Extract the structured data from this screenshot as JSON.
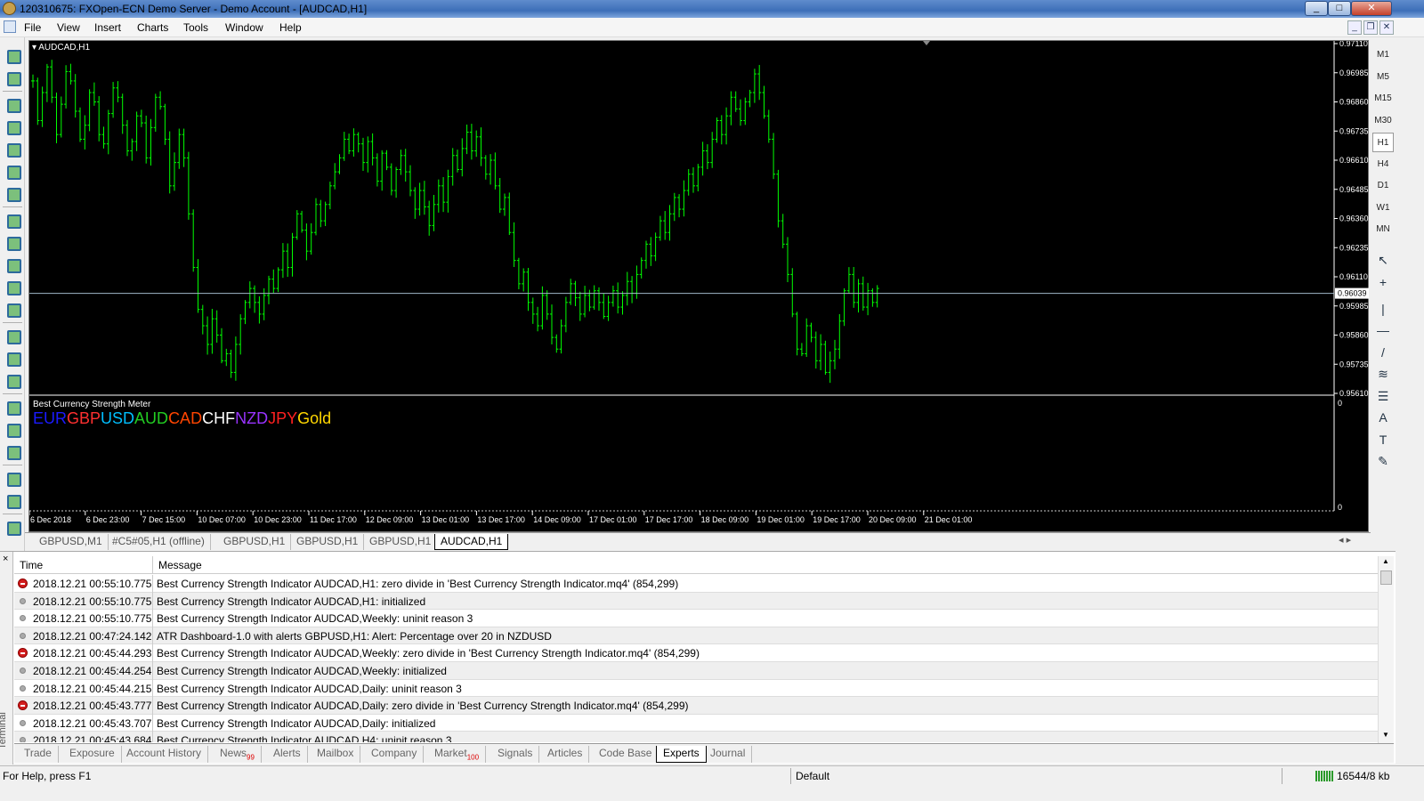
{
  "window": {
    "title": "120310675: FXOpen-ECN Demo Server - Demo Account - [AUDCAD,H1]",
    "min_label": "_",
    "max_label": "□",
    "close_label": "✕"
  },
  "menu": {
    "items": [
      "File",
      "View",
      "Insert",
      "Charts",
      "Tools",
      "Window",
      "Help"
    ],
    "mdi_buttons": [
      "_",
      "❐",
      "✕"
    ]
  },
  "chart": {
    "symbol_label": "▾ AUDCAD,H1",
    "indicator_label": "Best Currency Strength Meter",
    "currencies": [
      {
        "name": "EUR",
        "color": "#1a1aff"
      },
      {
        "name": "GBP",
        "color": "#ff3030"
      },
      {
        "name": "USD",
        "color": "#00bfff"
      },
      {
        "name": "AUD",
        "color": "#22cc22"
      },
      {
        "name": "CAD",
        "color": "#ff4500"
      },
      {
        "name": "CHF",
        "color": "#ffffff"
      },
      {
        "name": "NZD",
        "color": "#9933ff"
      },
      {
        "name": "JPY",
        "color": "#ff2020"
      },
      {
        "name": "Gold",
        "color": "#ffd700"
      }
    ],
    "price_labels": [
      "0.97110",
      "0.96985",
      "0.96860",
      "0.96735",
      "0.96610",
      "0.96485",
      "0.96360",
      "0.96235",
      "0.96110",
      "0.95985",
      "0.95860",
      "0.95735",
      "0.95610"
    ],
    "current_price": "0.96039",
    "indicator_scale_top": "0",
    "indicator_scale_bottom": "0",
    "time_labels": [
      "6 Dec 2018",
      "6 Dec 23:00",
      "7 Dec 15:00",
      "10 Dec 07:00",
      "10 Dec 23:00",
      "11 Dec 17:00",
      "12 Dec 09:00",
      "13 Dec 01:00",
      "13 Dec 17:00",
      "14 Dec 09:00",
      "17 Dec 01:00",
      "17 Dec 17:00",
      "18 Dec 09:00",
      "19 Dec 01:00",
      "19 Dec 17:00",
      "20 Dec 09:00",
      "21 Dec 01:00"
    ],
    "bar_color": "#00ff00",
    "chart_data": {
      "type": "ohlc",
      "ylim": [
        0.9561,
        0.9711
      ],
      "closes": [
        0.9695,
        0.9678,
        0.969,
        0.9701,
        0.9688,
        0.9672,
        0.9685,
        0.9699,
        0.9695,
        0.9682,
        0.967,
        0.9676,
        0.969,
        0.9686,
        0.9672,
        0.9668,
        0.9681,
        0.9692,
        0.9688,
        0.9676,
        0.9665,
        0.9669,
        0.968,
        0.9677,
        0.9662,
        0.9675,
        0.9688,
        0.9684,
        0.967,
        0.965,
        0.966,
        0.9672,
        0.9662,
        0.9638,
        0.9615,
        0.9597,
        0.959,
        0.9582,
        0.9593,
        0.9586,
        0.9575,
        0.9578,
        0.957,
        0.9582,
        0.9593,
        0.96,
        0.9606,
        0.96,
        0.9595,
        0.9603,
        0.961,
        0.9606,
        0.9614,
        0.9622,
        0.9615,
        0.9628,
        0.9638,
        0.9631,
        0.9622,
        0.963,
        0.9642,
        0.9635,
        0.9642,
        0.965,
        0.9656,
        0.9662,
        0.967,
        0.9665,
        0.9672,
        0.9668,
        0.966,
        0.9669,
        0.9662,
        0.9652,
        0.9664,
        0.9658,
        0.9648,
        0.9657,
        0.9663,
        0.9656,
        0.9648,
        0.964,
        0.9648,
        0.9641,
        0.9633,
        0.9642,
        0.965,
        0.9643,
        0.9654,
        0.9663,
        0.9657,
        0.9666,
        0.9673,
        0.9665,
        0.9671,
        0.9662,
        0.9655,
        0.9661,
        0.965,
        0.964,
        0.9645,
        0.963,
        0.9618,
        0.9608,
        0.9613,
        0.96,
        0.9595,
        0.959,
        0.9603,
        0.9595,
        0.9585,
        0.958,
        0.959,
        0.96,
        0.9608,
        0.9602,
        0.9595,
        0.9603,
        0.9598,
        0.9605,
        0.96,
        0.9594,
        0.96,
        0.9605,
        0.9598,
        0.9603,
        0.9609,
        0.9604,
        0.9612,
        0.9618,
        0.9625,
        0.962,
        0.9628,
        0.9635,
        0.963,
        0.9638,
        0.9645,
        0.964,
        0.9648,
        0.9655,
        0.965,
        0.9658,
        0.9665,
        0.966,
        0.967,
        0.9678,
        0.9672,
        0.968,
        0.9688,
        0.9683,
        0.9678,
        0.9686,
        0.969,
        0.9698,
        0.969,
        0.968,
        0.967,
        0.9655,
        0.9635,
        0.9625,
        0.9612,
        0.9595,
        0.958,
        0.9578,
        0.959,
        0.9585,
        0.9575,
        0.9582,
        0.957,
        0.9575,
        0.958,
        0.9592,
        0.9605,
        0.9612,
        0.96,
        0.9608,
        0.9598,
        0.9605,
        0.96,
        0.9606
      ]
    }
  },
  "chart_tabs": [
    "GBPUSD,M1",
    "#C5#05,H1 (offline)",
    "GBPUSD,H1",
    "GBPUSD,H1",
    "GBPUSD,H1",
    "AUDCAD,H1"
  ],
  "chart_tabs_active": 5,
  "chart_tabs_arrows": "◂  ▸",
  "timeframes": [
    "M1",
    "M5",
    "M15",
    "M30",
    "H1",
    "H4",
    "D1",
    "W1",
    "MN"
  ],
  "timeframe_active": "H1",
  "right_tools": [
    "↖",
    "+",
    "|",
    "—",
    "/",
    "≋",
    "☰",
    "A",
    "T",
    "✎"
  ],
  "terminal": {
    "close_label": "×",
    "side_label": "Terminal",
    "col_time": "Time",
    "col_message": "Message",
    "rows": [
      {
        "icon": "err",
        "time": "2018.12.21 00:55:10.775",
        "msg": "Best Currency Strength Indicator AUDCAD,H1: zero divide in 'Best Currency Strength Indicator.mq4' (854,299)"
      },
      {
        "icon": "info",
        "time": "2018.12.21 00:55:10.775",
        "msg": "Best Currency Strength Indicator AUDCAD,H1: initialized"
      },
      {
        "icon": "info",
        "time": "2018.12.21 00:55:10.775",
        "msg": "Best Currency Strength Indicator AUDCAD,Weekly: uninit reason 3"
      },
      {
        "icon": "info",
        "time": "2018.12.21 00:47:24.142",
        "msg": "ATR Dashboard-1.0 with alerts GBPUSD,H1: Alert: Percentage over 20 in NZDUSD"
      },
      {
        "icon": "err",
        "time": "2018.12.21 00:45:44.293",
        "msg": "Best Currency Strength Indicator AUDCAD,Weekly: zero divide in 'Best Currency Strength Indicator.mq4' (854,299)"
      },
      {
        "icon": "info",
        "time": "2018.12.21 00:45:44.254",
        "msg": "Best Currency Strength Indicator AUDCAD,Weekly: initialized"
      },
      {
        "icon": "info",
        "time": "2018.12.21 00:45:44.215",
        "msg": "Best Currency Strength Indicator AUDCAD,Daily: uninit reason 3"
      },
      {
        "icon": "err",
        "time": "2018.12.21 00:45:43.777",
        "msg": "Best Currency Strength Indicator AUDCAD,Daily: zero divide in 'Best Currency Strength Indicator.mq4' (854,299)"
      },
      {
        "icon": "info",
        "time": "2018.12.21 00:45:43.707",
        "msg": "Best Currency Strength Indicator AUDCAD,Daily: initialized"
      },
      {
        "icon": "info",
        "time": "2018.12.21 00:45:43.684",
        "msg": "Best Currency Strength Indicator AUDCAD,H4: uninit reason 3"
      }
    ],
    "tabs": [
      {
        "label": "Trade"
      },
      {
        "label": "Exposure"
      },
      {
        "label": "Account History"
      },
      {
        "label": "News",
        "badge": "99"
      },
      {
        "label": "Alerts"
      },
      {
        "label": "Mailbox"
      },
      {
        "label": "Company"
      },
      {
        "label": "Market",
        "badge": "100"
      },
      {
        "label": "Signals"
      },
      {
        "label": "Articles"
      },
      {
        "label": "Code Base"
      },
      {
        "label": "Experts"
      },
      {
        "label": "Journal"
      }
    ],
    "active_tab": "Experts"
  },
  "status": {
    "help": "For Help, press F1",
    "profile": "Default",
    "traffic": "16544/8 kb"
  }
}
